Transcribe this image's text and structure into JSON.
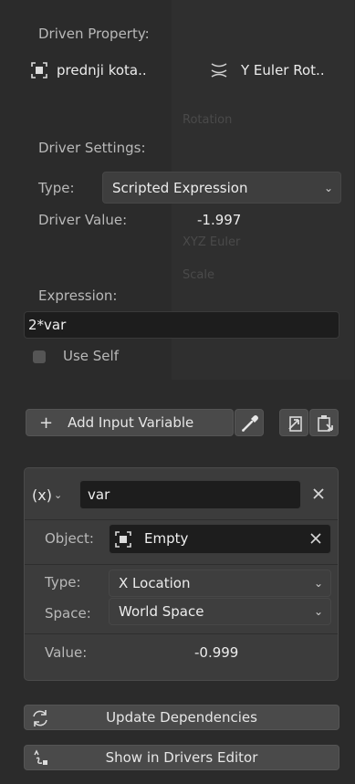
{
  "driven_property": {
    "heading": "Driven Property:",
    "object_name": "prednji kota..",
    "property_name": "Y Euler Rot.."
  },
  "driver_settings": {
    "heading": "Driver Settings:",
    "type_label": "Type:",
    "type_value": "Scripted Expression",
    "value_label": "Driver Value:",
    "value": "-1.997"
  },
  "expression": {
    "heading": "Expression:",
    "value": "2*var",
    "use_self_label": "Use Self"
  },
  "variables": {
    "add_label": "Add Input Variable",
    "plus": "+",
    "variable": {
      "type_token": "(x)",
      "name": "var",
      "object_label": "Object:",
      "object_value": "Empty",
      "type_label": "Type:",
      "type_value": "X Location",
      "space_label": "Space:",
      "space_value": "World Space",
      "value_label": "Value:",
      "value": "-0.999"
    }
  },
  "actions": {
    "update_label": "Update Dependencies",
    "show_editor_label": "Show in Drivers Editor"
  },
  "background_text": [
    "Rotation",
    "XYZ Euler",
    "Scale"
  ],
  "colors": {
    "background": "#2b2b2b",
    "field": "#1d1d1d",
    "button": "#4a4a4a",
    "accent_red": "#b8302f"
  }
}
